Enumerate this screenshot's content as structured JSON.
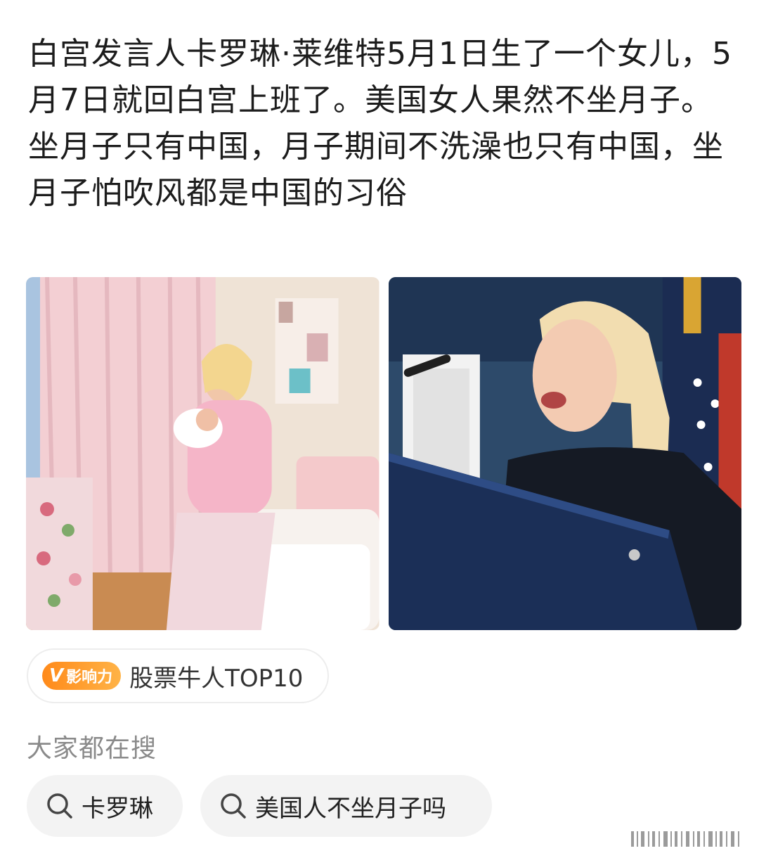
{
  "post": {
    "paragraph1": "白宫发言人卡罗琳·莱维特5月1日生了一个女儿，5月7日就回白宫上班了。美国女人果然不坐月子。",
    "paragraph2": "坐月子只有中国，月子期间不洗澡也只有中国，坐月子怕吹风都是中国的习俗"
  },
  "topic": {
    "badge_v": "V",
    "badge_text": "影响力",
    "label": "股票牛人TOP10",
    "accent": "#ff8a1a"
  },
  "search": {
    "heading": "大家都在搜",
    "chips": [
      {
        "label": "卡罗琳",
        "icon": "search-icon"
      },
      {
        "label": "美国人不坐月子吗",
        "icon": "search-icon"
      }
    ]
  },
  "photos": [
    {
      "icon": "photo-nursery"
    },
    {
      "icon": "photo-press-briefing"
    }
  ]
}
